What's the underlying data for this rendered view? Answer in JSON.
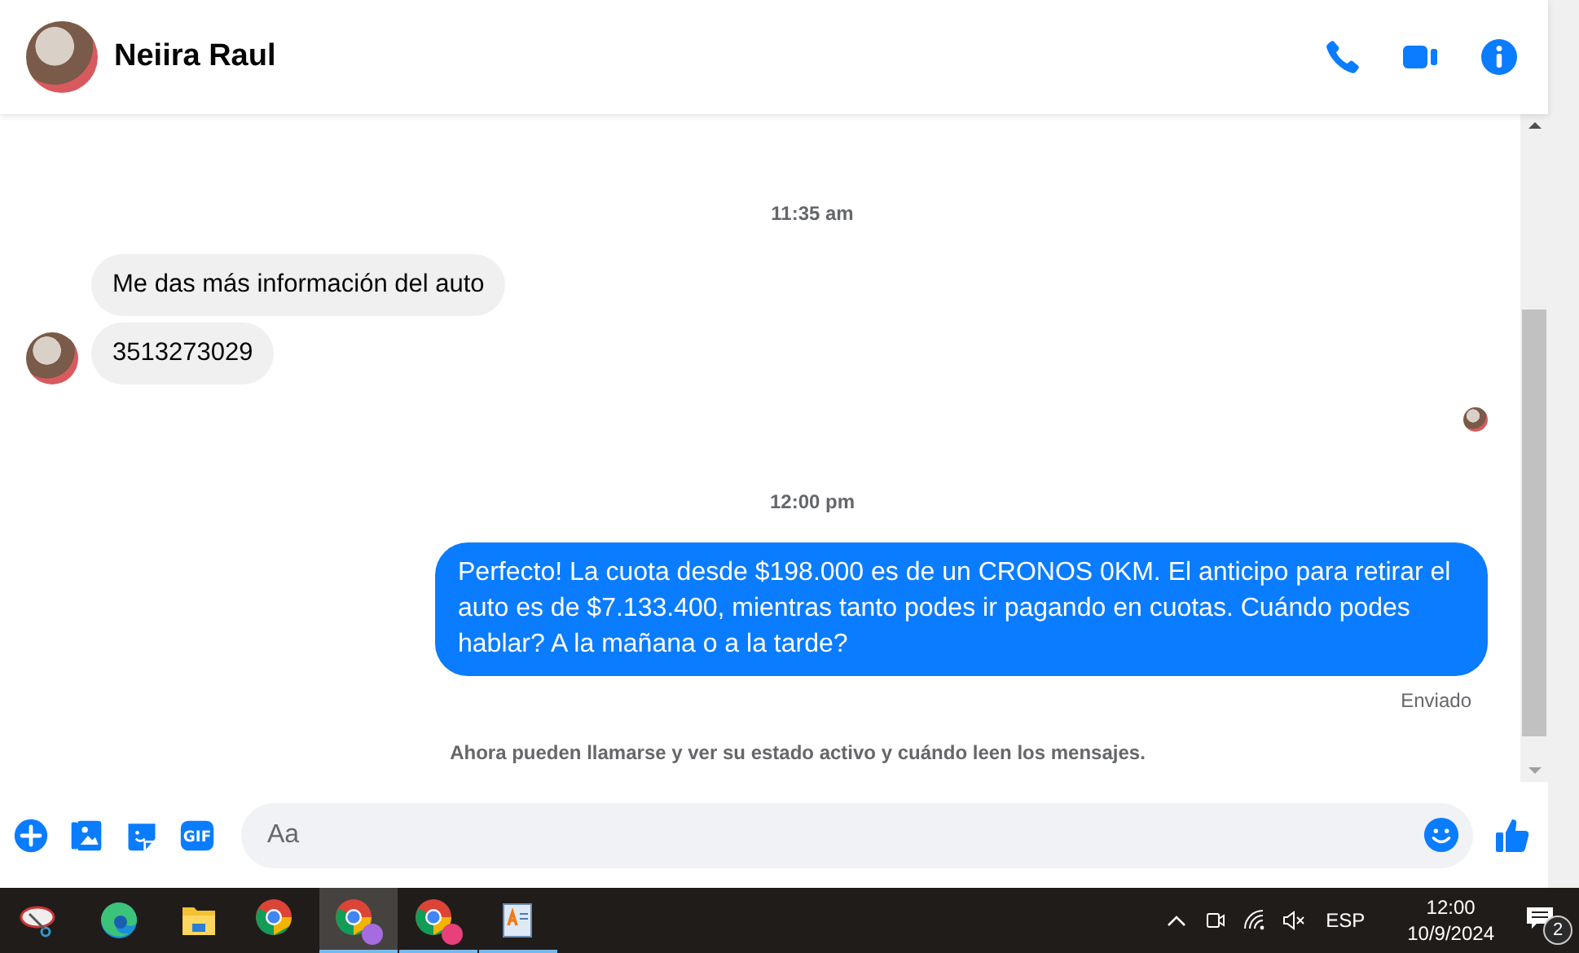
{
  "header": {
    "name": "Neiira Raul"
  },
  "messages": [
    {
      "kind": "timestamp",
      "text": "11:35 am"
    },
    {
      "kind": "incoming",
      "text": "Me das más información del auto",
      "avatar": false
    },
    {
      "kind": "incoming",
      "text": "3513273029",
      "avatar": true
    },
    {
      "kind": "seen"
    },
    {
      "kind": "timestamp",
      "text": "12:00 pm"
    },
    {
      "kind": "outgoing",
      "text": "Perfecto! La cuota desde $198.000 es de un CRONOS 0KM. El anticipo para retirar el auto es de $7.133.400, mientras tanto podes ir pagando en cuotas. Cuándo podes hablar? A la mañana o a la tarde?"
    },
    {
      "kind": "status",
      "text": "Enviado"
    },
    {
      "kind": "notice",
      "text": "Ahora pueden llamarse y ver su estado activo y cuándo leen los mensajes."
    }
  ],
  "composer": {
    "placeholder": "Aa",
    "gif_label": "GIF"
  },
  "taskbar": {
    "apps": [
      {
        "kind": "snip",
        "selected": false,
        "running": false
      },
      {
        "kind": "edge",
        "selected": false,
        "running": false
      },
      {
        "kind": "folder",
        "selected": false,
        "running": false
      },
      {
        "kind": "chrome",
        "selected": false,
        "running": false
      },
      {
        "kind": "chrome-profile",
        "selected": true,
        "running": true
      },
      {
        "kind": "chrome-badge",
        "selected": false,
        "running": true
      },
      {
        "kind": "doc",
        "selected": false,
        "running": true
      }
    ],
    "language": "ESP",
    "time": "12:00",
    "date": "10/9/2024",
    "notifications": "2"
  }
}
